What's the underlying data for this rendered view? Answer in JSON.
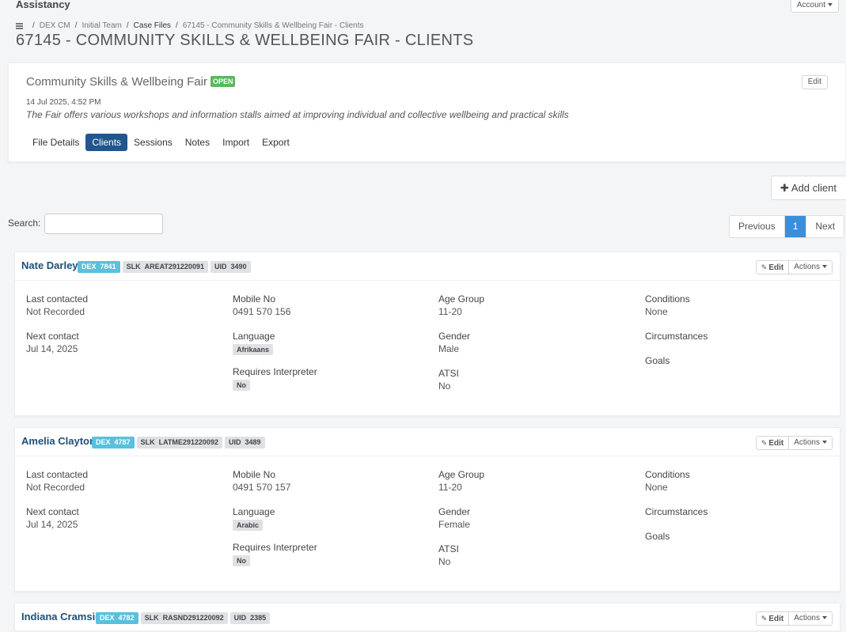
{
  "app": {
    "title": "Assistancy",
    "account_label": "Account"
  },
  "breadcrumb": {
    "items": [
      "DEX CM",
      "Initial Team",
      "Case Files",
      "67145 - Community Skills & Wellbeing Fair - Clients"
    ]
  },
  "page_title": "67145 - COMMUNITY SKILLS & WELLBEING FAIR - CLIENTS",
  "file": {
    "name": "Community Skills & Wellbeing Fair",
    "status": "OPEN",
    "edit_label": "Edit",
    "date": "14 Jul 2025, 4:52 PM",
    "description": "The Fair offers various workshops and information stalls aimed at improving individual and collective wellbeing and practical skills",
    "tabs": [
      "File Details",
      "Clients",
      "Sessions",
      "Notes",
      "Import",
      "Export"
    ],
    "active_tab": "Clients"
  },
  "add_client_label": "Add client",
  "search": {
    "label": "Search:"
  },
  "pager": {
    "previous": "Previous",
    "current": "1",
    "next": "Next"
  },
  "card_labels": {
    "last_contacted": "Last contacted",
    "next_contact": "Next contact",
    "mobile": "Mobile No",
    "language": "Language",
    "interpreter": "Requires Interpreter",
    "age_group": "Age Group",
    "gender": "Gender",
    "atsi": "ATSI",
    "conditions": "Conditions",
    "circumstances": "Circumstances",
    "goals": "Goals",
    "edit": "Edit",
    "actions": "Actions"
  },
  "clients": [
    {
      "name": "Nate Darley",
      "dex_label": "DEX",
      "dex": "7841",
      "slk_label": "SLK",
      "slk": "AREAT291220091",
      "uid_label": "UID",
      "uid": "3490",
      "last_contacted": "Not Recorded",
      "next_contact": "Jul 14, 2025",
      "mobile": "0491 570 156",
      "language": "Afrikaans",
      "interpreter": "No",
      "age_group": "11-20",
      "gender": "Male",
      "atsi": "No",
      "conditions": "None"
    },
    {
      "name": "Amelia Clayton",
      "dex_label": "DEX",
      "dex": "4787",
      "slk_label": "SLK",
      "slk": "LATME291220092",
      "uid_label": "UID",
      "uid": "3489",
      "last_contacted": "Not Recorded",
      "next_contact": "Jul 14, 2025",
      "mobile": "0491 570 157",
      "language": "Arabic",
      "interpreter": "No",
      "age_group": "11-20",
      "gender": "Female",
      "atsi": "No",
      "conditions": "None"
    },
    {
      "name": "Indiana Cramsie",
      "dex_label": "DEX",
      "dex": "4782",
      "slk_label": "SLK",
      "slk": "RASND291220092",
      "uid_label": "UID",
      "uid": "2385"
    }
  ]
}
